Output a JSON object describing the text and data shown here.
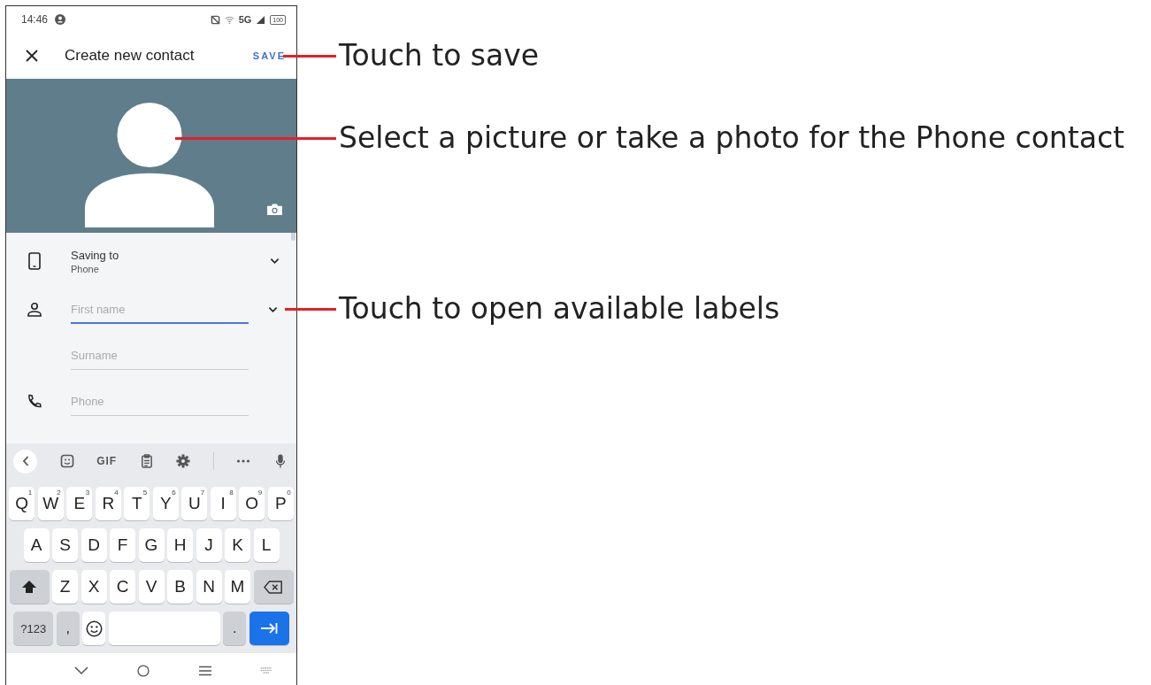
{
  "status_bar": {
    "time": "14:46",
    "network": "5G",
    "battery": "100"
  },
  "header": {
    "title": "Create new contact",
    "save": "SAVE"
  },
  "form": {
    "saving_label": "Saving to",
    "saving_value": "Phone",
    "fields": [
      {
        "placeholder": "First name",
        "focused": true
      },
      {
        "placeholder": "Surname",
        "focused": false
      },
      {
        "placeholder": "Phone",
        "focused": false
      }
    ]
  },
  "keyboard": {
    "gif": "GIF",
    "rows": [
      {
        "keys": [
          {
            "kind": "letter",
            "label": "Q",
            "hint": "1"
          },
          {
            "kind": "letter",
            "label": "W",
            "hint": "2"
          },
          {
            "kind": "letter",
            "label": "E",
            "hint": "3"
          },
          {
            "kind": "letter",
            "label": "R",
            "hint": "4"
          },
          {
            "kind": "letter",
            "label": "T",
            "hint": "5"
          },
          {
            "kind": "letter",
            "label": "Y",
            "hint": "6"
          },
          {
            "kind": "letter",
            "label": "U",
            "hint": "7"
          },
          {
            "kind": "letter",
            "label": "I",
            "hint": "8"
          },
          {
            "kind": "letter",
            "label": "O",
            "hint": "9"
          },
          {
            "kind": "letter",
            "label": "P",
            "hint": "0"
          }
        ]
      },
      {
        "keys": [
          {
            "kind": "letter",
            "label": "A"
          },
          {
            "kind": "letter",
            "label": "S"
          },
          {
            "kind": "letter",
            "label": "D"
          },
          {
            "kind": "letter",
            "label": "F"
          },
          {
            "kind": "letter",
            "label": "G"
          },
          {
            "kind": "letter",
            "label": "H"
          },
          {
            "kind": "letter",
            "label": "J"
          },
          {
            "kind": "letter",
            "label": "K"
          },
          {
            "kind": "letter",
            "label": "L"
          }
        ]
      },
      {
        "keys": [
          {
            "kind": "shift"
          },
          {
            "kind": "letter",
            "label": "Z"
          },
          {
            "kind": "letter",
            "label": "X"
          },
          {
            "kind": "letter",
            "label": "C"
          },
          {
            "kind": "letter",
            "label": "V"
          },
          {
            "kind": "letter",
            "label": "B"
          },
          {
            "kind": "letter",
            "label": "N"
          },
          {
            "kind": "letter",
            "label": "M"
          },
          {
            "kind": "backspace"
          }
        ]
      },
      {
        "keys": [
          {
            "kind": "symbols",
            "label": "?123"
          },
          {
            "kind": "punct",
            "label": ","
          },
          {
            "kind": "emoji"
          },
          {
            "kind": "space"
          },
          {
            "kind": "punct",
            "label": "."
          },
          {
            "kind": "enter"
          }
        ]
      }
    ]
  },
  "callouts": [
    {
      "text": "Touch to save"
    },
    {
      "text": "Select a picture or take a photo for the Phone contact"
    },
    {
      "text": "Touch to open available labels"
    }
  ]
}
